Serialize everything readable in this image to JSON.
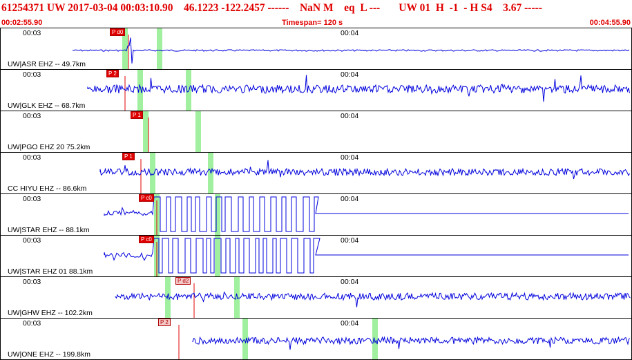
{
  "header": {
    "line1": "61254371 UW 2017-03-04 00:03:10.90    46.1223 -122.2457 ------    NaN M    eq  L ---       UW 01  H  -1  - H S4    3.67 -----",
    "start_time": "00:02:55.90",
    "timespan": "Timespan= 120 s",
    "end_time": "00:04:55.90"
  },
  "time_ticks": [
    "00:03",
    "00:04"
  ],
  "colors": {
    "header": "#e00000",
    "trace": "#0000dd",
    "marker": "#a0f0a0",
    "pick": "#e00000"
  },
  "channels": [
    {
      "label": "UW|ASR EHZ -- 49.7km",
      "pick": "P d0",
      "pick_style": "red"
    },
    {
      "label": "UW|GLK EHZ -- 68.7km",
      "pick": "P 2",
      "pick_style": "red"
    },
    {
      "label": "UW|PGO EHZ 20 75.2km",
      "pick": "P 1",
      "pick_style": "red"
    },
    {
      "label": "CC HIYU EHZ -- 86.6km",
      "pick": "P 1",
      "pick_style": "red"
    },
    {
      "label": "UW|STAR EHZ -- 88.1km",
      "pick": "P c0",
      "pick_style": "red"
    },
    {
      "label": "UW|STAR EHZ 01 88.1km",
      "pick": "P c0",
      "pick_style": "red"
    },
    {
      "label": "UW|GHW EHZ -- 102.2km",
      "pick": "P d2",
      "pick_style": "pink"
    },
    {
      "label": "UW|ONE EHZ -- 199.8km",
      "pick": "P 2",
      "pick_style": "pink"
    }
  ]
}
